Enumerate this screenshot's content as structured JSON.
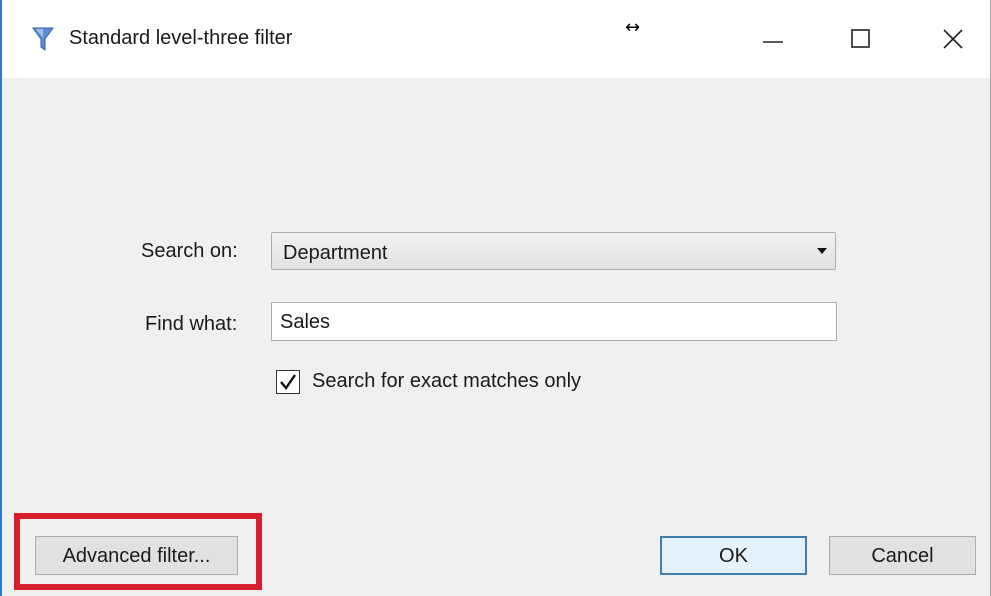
{
  "window": {
    "title": "Standard level-three filter",
    "icons": {
      "app": "filter-funnel-icon",
      "resize": "resize-horizontal-icon"
    },
    "resize_glyph": "↔"
  },
  "form": {
    "search_on_label": "Search on:",
    "search_on_value": "Department",
    "find_what_label": "Find what:",
    "find_what_value": "Sales",
    "exact_match_label": "Search for exact matches only",
    "exact_match_checked": true
  },
  "buttons": {
    "advanced": "Advanced filter...",
    "ok": "OK",
    "cancel": "Cancel"
  },
  "colors": {
    "highlight": "#d61f2b",
    "window_border": "#2b7bd6",
    "default_button_border": "#3c7fb1"
  }
}
